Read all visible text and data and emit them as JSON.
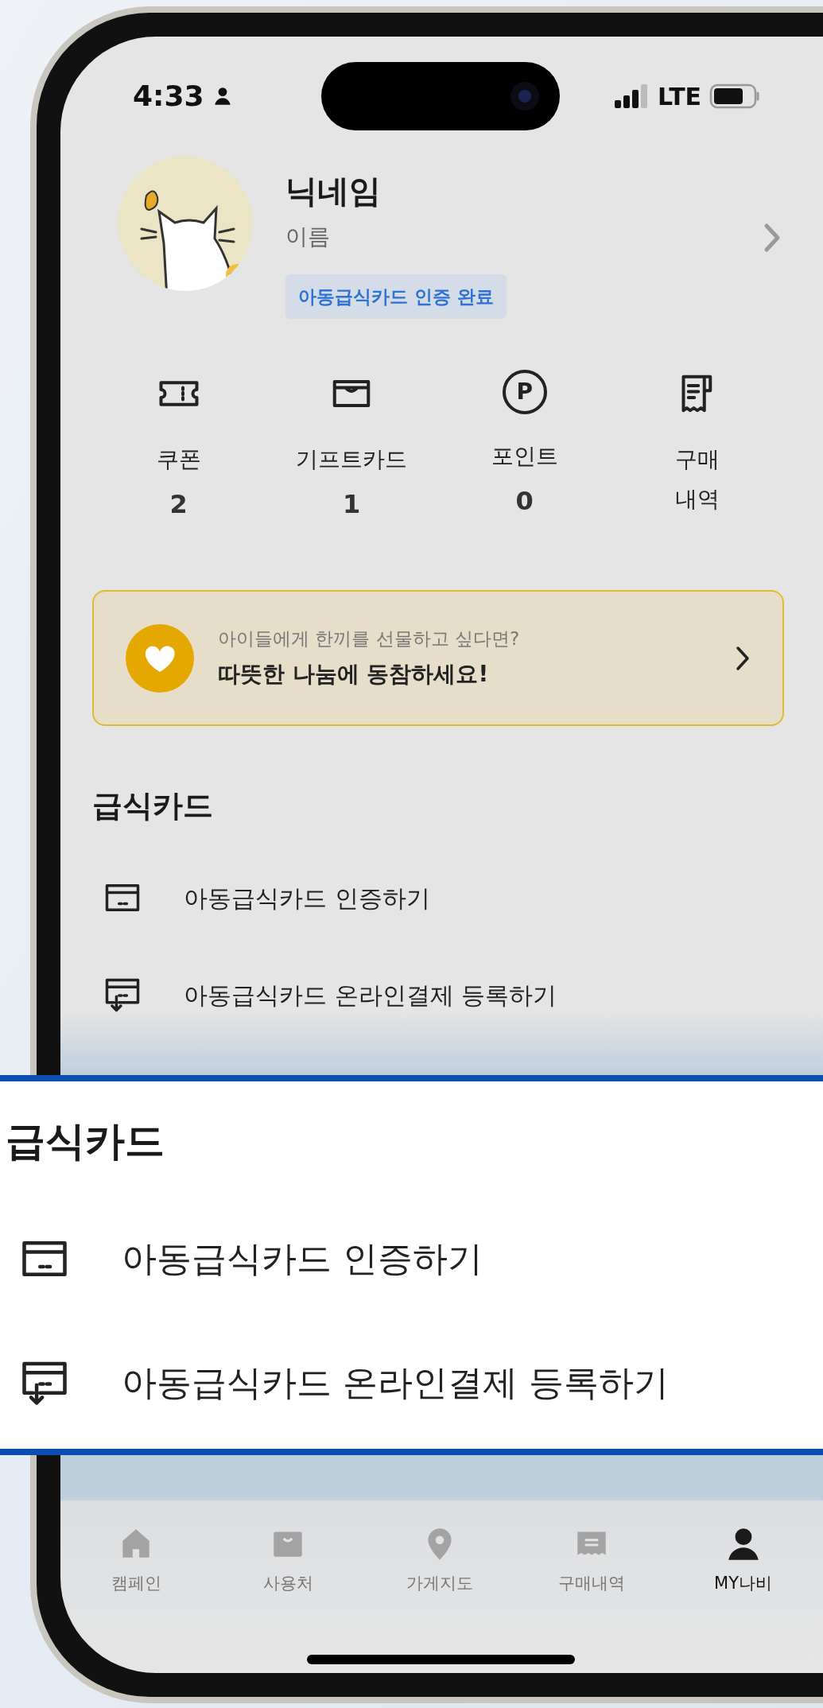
{
  "status_bar": {
    "time": "4:33",
    "network": "LTE"
  },
  "profile": {
    "nickname": "닉네임",
    "name": "이름",
    "badge": "아동급식카드 인증 완료"
  },
  "stats": [
    {
      "kind": "coupon",
      "label": "쿠폰",
      "value": "2"
    },
    {
      "kind": "giftcard",
      "label": "기프트카드",
      "value": "1"
    },
    {
      "kind": "point",
      "icon": "P",
      "label": "포인트",
      "value": "0"
    },
    {
      "kind": "history",
      "label": "구매내역"
    }
  ],
  "banner": {
    "subtitle": "아이들에게 한끼를 선물하고 싶다면?",
    "title": "따뜻한 나눔에 동참하세요!"
  },
  "meal_card": {
    "title": "급식카드",
    "items": [
      {
        "kind": "verify",
        "label": "아동급식카드 인증하기"
      },
      {
        "kind": "register",
        "label": "아동급식카드 온라인결제 등록하기"
      }
    ]
  },
  "callout": {
    "title": "급식카드",
    "items": [
      {
        "kind": "verify",
        "label": "아동급식카드 인증하기"
      },
      {
        "kind": "register",
        "label": "아동급식카드 온라인결제 등록하기"
      }
    ]
  },
  "tab_bar": [
    {
      "kind": "home",
      "label": "캠페인",
      "selected": false
    },
    {
      "kind": "bag",
      "label": "사용처",
      "selected": false
    },
    {
      "kind": "pin",
      "label": "가게지도",
      "selected": false
    },
    {
      "kind": "receipt",
      "label": "구매내역",
      "selected": false
    },
    {
      "kind": "person",
      "label": "MY나비",
      "selected": true
    }
  ]
}
